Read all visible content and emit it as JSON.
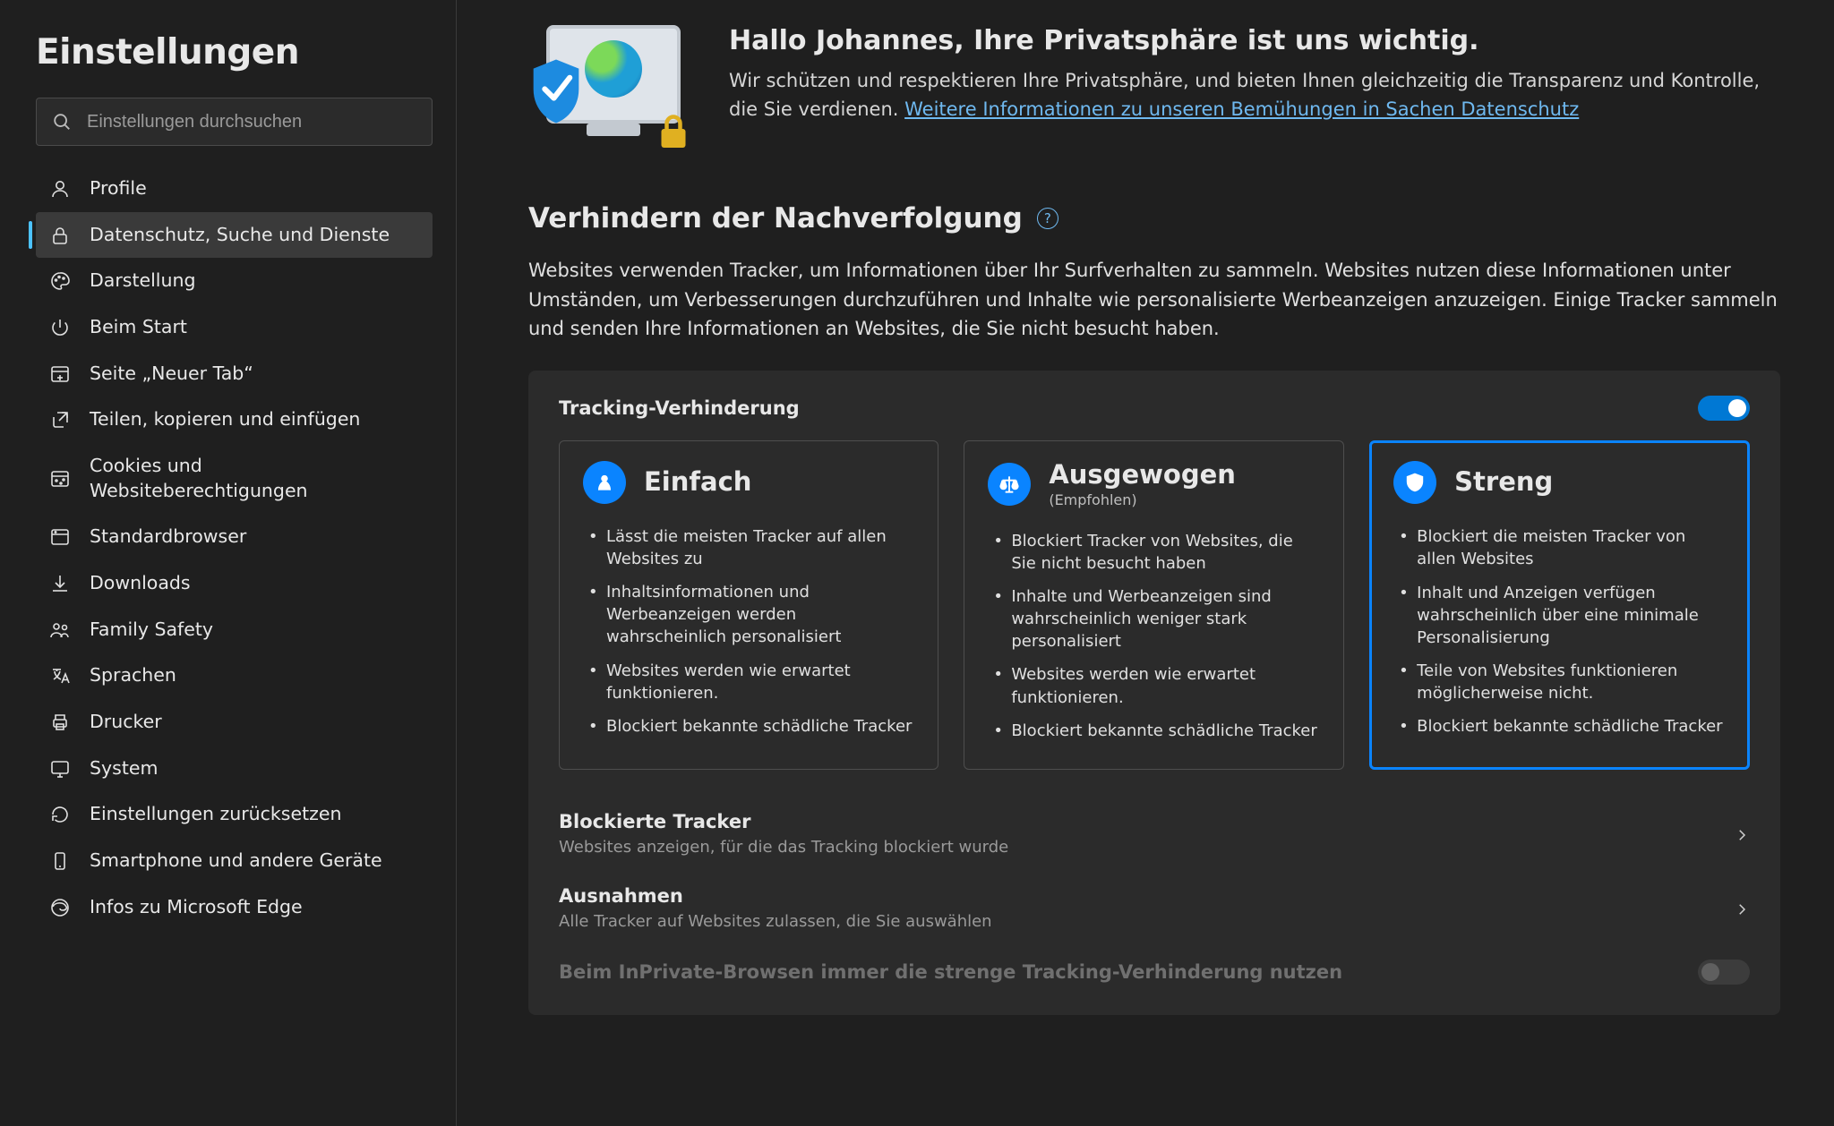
{
  "sidebar": {
    "title": "Einstellungen",
    "search_placeholder": "Einstellungen durchsuchen",
    "items": [
      {
        "label": "Profile",
        "icon": "profile"
      },
      {
        "label": "Datenschutz, Suche und Dienste",
        "icon": "lock"
      },
      {
        "label": "Darstellung",
        "icon": "palette"
      },
      {
        "label": "Beim Start",
        "icon": "power"
      },
      {
        "label": "Seite „Neuer Tab“",
        "icon": "newtab"
      },
      {
        "label": "Teilen, kopieren und einfügen",
        "icon": "share"
      },
      {
        "label": "Cookies und Websiteberechtigungen",
        "icon": "cookies"
      },
      {
        "label": "Standardbrowser",
        "icon": "browser"
      },
      {
        "label": "Downloads",
        "icon": "download"
      },
      {
        "label": "Family Safety",
        "icon": "family"
      },
      {
        "label": "Sprachen",
        "icon": "language"
      },
      {
        "label": "Drucker",
        "icon": "printer"
      },
      {
        "label": "System",
        "icon": "system"
      },
      {
        "label": "Einstellungen zurücksetzen",
        "icon": "reset"
      },
      {
        "label": "Smartphone und andere Geräte",
        "icon": "phone"
      },
      {
        "label": "Infos zu Microsoft Edge",
        "icon": "edge"
      }
    ],
    "active_index": 1
  },
  "hero": {
    "title": "Hallo Johannes, Ihre Privatsphäre ist uns wichtig.",
    "body_pre": "Wir schützen und respektieren Ihre Privatsphäre, und bieten Ihnen gleichzeitig die Transparenz und Kontrolle, die Sie verdienen. ",
    "link": "Weitere Informationen zu unseren Bemühungen in Sachen Datenschutz"
  },
  "tracking": {
    "section_title": "Verhindern der Nachverfolgung",
    "section_desc": "Websites verwenden Tracker, um Informationen über Ihr Surfverhalten zu sammeln. Websites nutzen diese Informationen unter Umständen, um Verbesserungen durchzuführen und Inhalte wie personalisierte Werbeanzeigen anzuzeigen. Einige Tracker sammeln und senden Ihre Informationen an Websites, die Sie nicht besucht haben.",
    "panel_title": "Tracking-Verhinderung",
    "toggle_on": true,
    "cards": [
      {
        "title": "Einfach",
        "subtitle": "",
        "bullets": [
          "Lässt die meisten Tracker auf allen Websites zu",
          "Inhaltsinformationen und Werbeanzeigen werden wahrscheinlich personalisiert",
          "Websites werden wie erwartet funktionieren.",
          "Blockiert bekannte schädliche Tracker"
        ]
      },
      {
        "title": "Ausgewogen",
        "subtitle": "(Empfohlen)",
        "bullets": [
          "Blockiert Tracker von Websites, die Sie nicht besucht haben",
          "Inhalte und Werbeanzeigen sind wahrscheinlich weniger stark personalisiert",
          "Websites werden wie erwartet funktionieren.",
          "Blockiert bekannte schädliche Tracker"
        ]
      },
      {
        "title": "Streng",
        "subtitle": "",
        "bullets": [
          "Blockiert die meisten Tracker von allen Websites",
          "Inhalt und Anzeigen verfügen wahrscheinlich über eine minimale Personalisierung",
          "Teile von Websites funktionieren möglicherweise nicht.",
          "Blockiert bekannte schädliche Tracker"
        ]
      }
    ],
    "selected_card_index": 2,
    "blocked": {
      "title": "Blockierte Tracker",
      "desc": "Websites anzeigen, für die das Tracking blockiert wurde"
    },
    "exceptions": {
      "title": "Ausnahmen",
      "desc": "Alle Tracker auf Websites zulassen, die Sie auswählen"
    },
    "inprivate_row": "Beim InPrivate-Browsen immer die strenge Tracking-Verhinderung nutzen"
  }
}
